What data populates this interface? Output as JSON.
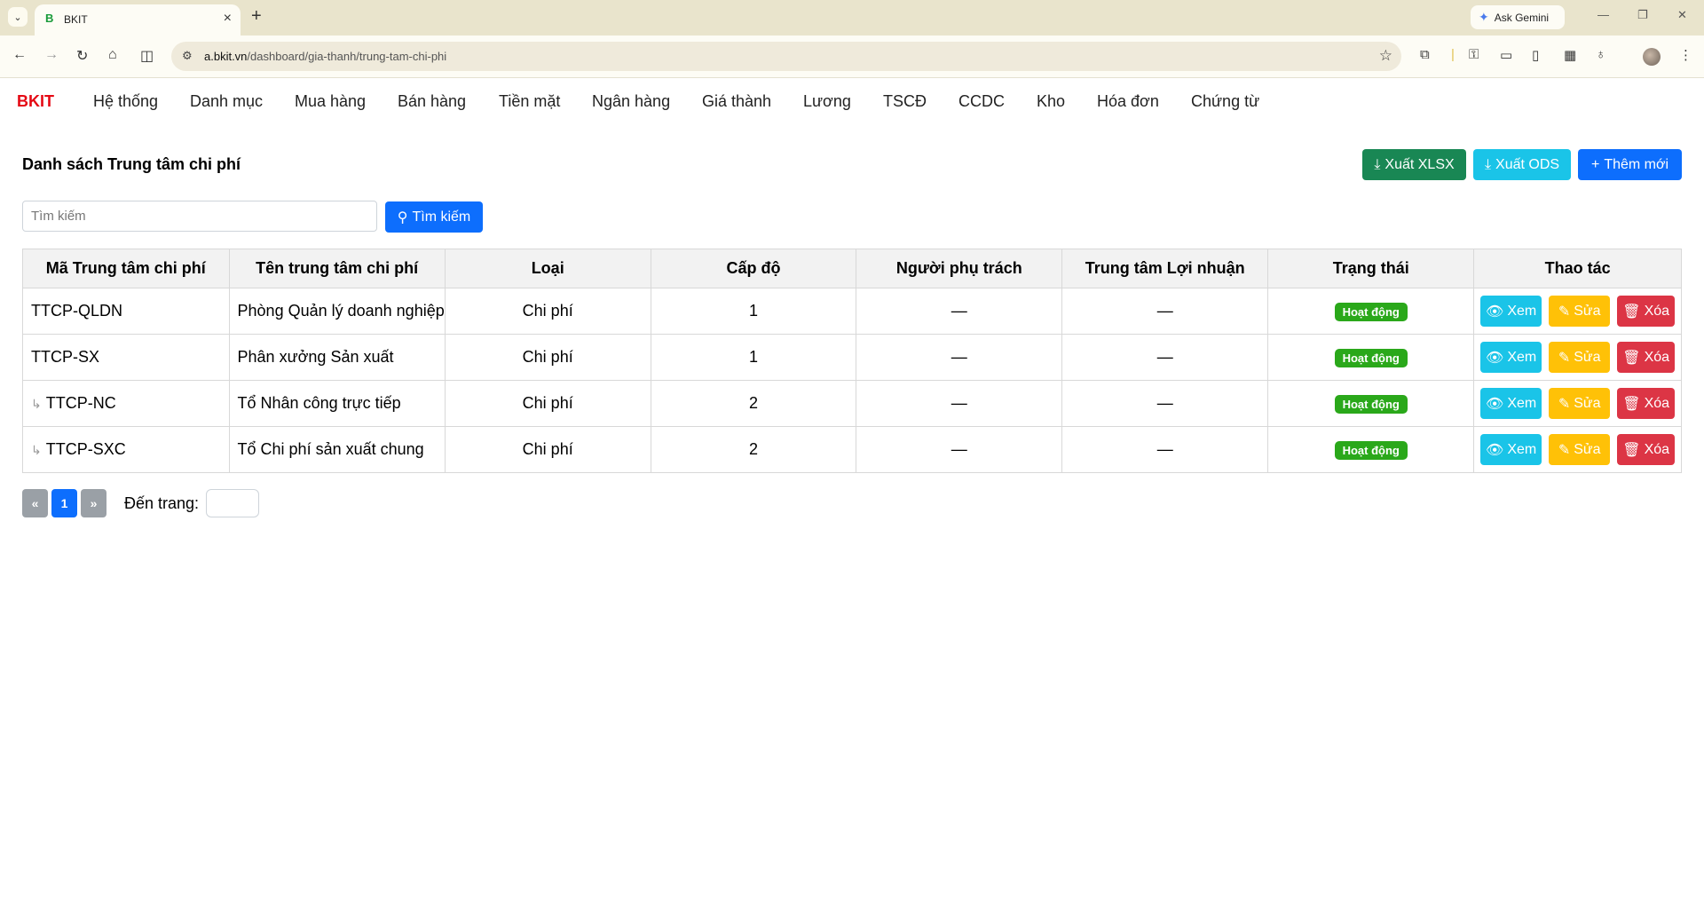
{
  "browser": {
    "tab_title": "BKIT",
    "tab_favicon": "B",
    "gemini_label": "Ask Gemini",
    "url_host": "a.bkit.vn",
    "url_path": "/dashboard/gia-thanh/trung-tam-chi-phi"
  },
  "app": {
    "brand": "BKIT",
    "menu": [
      "Hệ thống",
      "Danh mục",
      "Mua hàng",
      "Bán hàng",
      "Tiền mặt",
      "Ngân hàng",
      "Giá thành",
      "Lương",
      "TSCĐ",
      "CCDC",
      "Kho",
      "Hóa đơn",
      "Chứng từ"
    ]
  },
  "page": {
    "title": "Danh sách Trung tâm chi phí",
    "export_xlsx": "Xuất XLSX",
    "export_ods": "Xuất ODS",
    "add_new": "Thêm mới",
    "search_placeholder": "Tìm kiếm",
    "search_button": "Tìm kiếm"
  },
  "table": {
    "headers": [
      "Mã Trung tâm chi phí",
      "Tên trung tâm chi phí",
      "Loại",
      "Cấp độ",
      "Người phụ trách",
      "Trung tâm Lợi nhuận",
      "Trạng thái",
      "Thao tác"
    ],
    "rows": [
      {
        "code": "TTCP-QLDN",
        "name": "Phòng Quản lý doanh nghiệp",
        "type": "Chi phí",
        "level": "1",
        "owner": "—",
        "profit_center": "—",
        "status": "Hoạt động"
      },
      {
        "code": "TTCP-SX",
        "name": "Phân xưởng Sản xuất",
        "type": "Chi phí",
        "level": "1",
        "owner": "—",
        "profit_center": "—",
        "status": "Hoạt động"
      },
      {
        "code": "TTCP-NC",
        "name": "Tổ Nhân công trực tiếp",
        "type": "Chi phí",
        "level": "2",
        "owner": "—",
        "profit_center": "—",
        "status": "Hoạt động"
      },
      {
        "code": "TTCP-SXC",
        "name": "Tổ Chi phí sản xuất chung",
        "type": "Chi phí",
        "level": "2",
        "owner": "—",
        "profit_center": "—",
        "status": "Hoạt động"
      }
    ],
    "actions": {
      "view": "Xem",
      "edit": "Sửa",
      "delete": "Xóa"
    },
    "child_marker": "↳"
  },
  "pager": {
    "prev": "«",
    "current": "1",
    "next": "»",
    "goto_label": "Đến trang:"
  }
}
